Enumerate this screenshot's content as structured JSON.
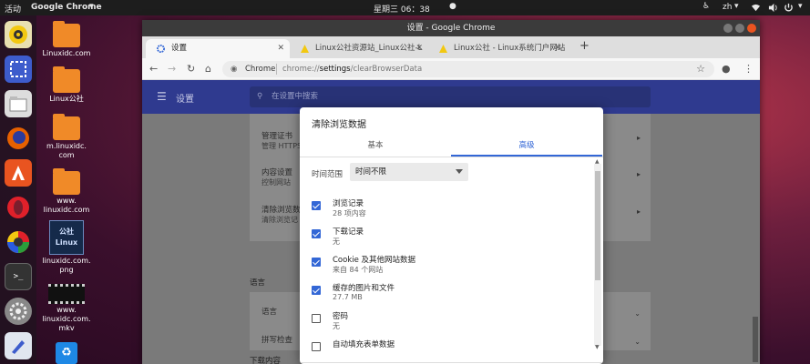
{
  "topbar": {
    "activities": "活动",
    "app_name": "Google Chrome",
    "clock": "星期三 06：38",
    "lang": "zh"
  },
  "desktop": {
    "icons": [
      {
        "label": "Linuxidc.com"
      },
      {
        "label": "Linux公社"
      },
      {
        "label": "m.linuxidc.\ncom"
      },
      {
        "label": "www.\nlinuxidc.com"
      },
      {
        "label": "linuxidc.com.\npng",
        "logo_text": "公社\nLinux"
      },
      {
        "label": "www.\nlinuxidc.com.\nmkv"
      }
    ]
  },
  "window": {
    "title": "设置 - Google Chrome",
    "tabs": [
      {
        "label": "设置",
        "active": true
      },
      {
        "label": "Linux公社资源站_Linux公社-L"
      },
      {
        "label": "Linux公社 - Linux系统门户网站"
      }
    ],
    "new_tab": "+",
    "omnibox": {
      "chip": "Chrome",
      "prefix": "chrome://",
      "bold": "settings",
      "rest": "/clearBrowserData"
    }
  },
  "settings": {
    "header_title": "设置",
    "search_placeholder": "在设置中搜索",
    "rows": [
      {
        "title": "管理证书",
        "sub": "管理 HTTPS"
      },
      {
        "title": "内容设置",
        "sub": "控制网站"
      },
      {
        "title": "清除浏览数",
        "sub": "清除浏览记"
      }
    ],
    "section_language": "语言",
    "lang_rows": [
      {
        "title": "语言"
      },
      {
        "title": "拼写检查"
      }
    ],
    "section_downloads": "下载内容"
  },
  "dialog": {
    "title": "清除浏览数据",
    "tab_basic": "基本",
    "tab_advanced": "高级",
    "time_range_label": "时间范围",
    "time_range_value": "时间不限",
    "options": [
      {
        "title": "浏览记录",
        "sub": "28 项内容",
        "checked": true
      },
      {
        "title": "下载记录",
        "sub": "无",
        "checked": true
      },
      {
        "title": "Cookie 及其他网站数据",
        "sub": "来自 84 个网站",
        "checked": true
      },
      {
        "title": "缓存的图片和文件",
        "sub": "27.7 MB",
        "checked": true
      },
      {
        "title": "密码",
        "sub": "无",
        "checked": false
      },
      {
        "title": "自动填充表单数据",
        "sub": "",
        "checked": false
      }
    ]
  },
  "colors": {
    "accent": "#3367d6",
    "header": "#2f3a8f"
  }
}
